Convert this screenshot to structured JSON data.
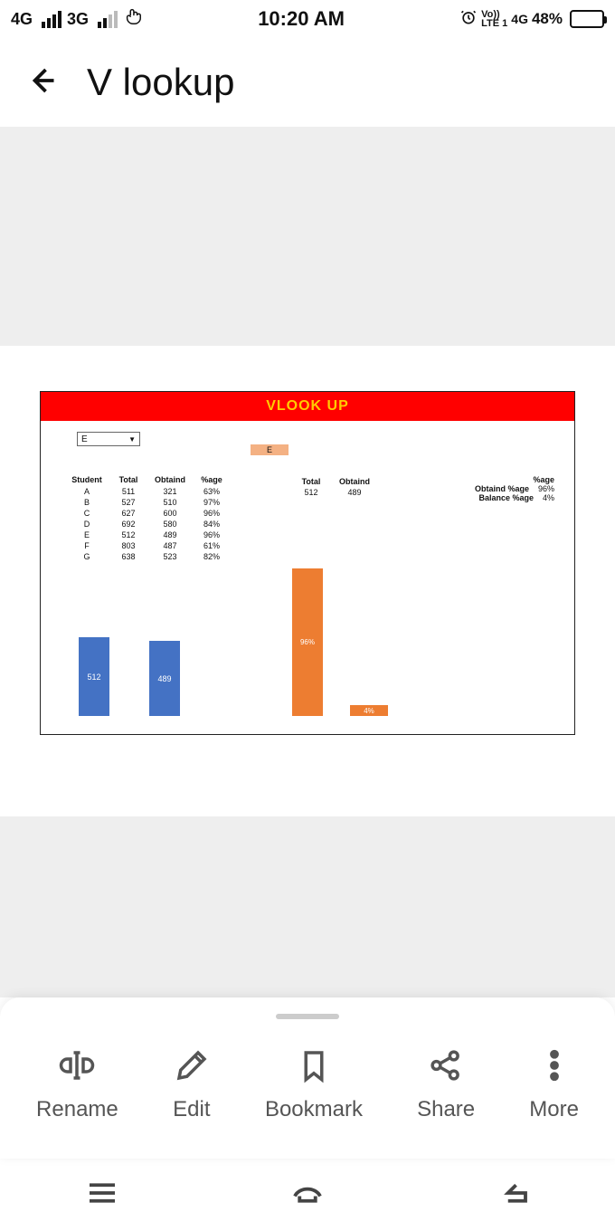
{
  "status": {
    "net1": "4G",
    "net2": "3G",
    "time": "10:20 AM",
    "volte_top": "Vo))",
    "volte_bot": "LTE 1",
    "net3": "4G",
    "battery_pct": "48%",
    "battery_fill": 48
  },
  "header": {
    "title": "V lookup"
  },
  "doc": {
    "title": "VLOOK UP",
    "dropdown_value": "E",
    "selected_chip": "E",
    "table_headers": [
      "Student",
      "Total",
      "Obtaind",
      "%age"
    ],
    "rows": [
      {
        "s": "A",
        "t": "511",
        "o": "321",
        "p": "63%"
      },
      {
        "s": "B",
        "t": "527",
        "o": "510",
        "p": "97%"
      },
      {
        "s": "C",
        "t": "627",
        "o": "600",
        "p": "96%"
      },
      {
        "s": "D",
        "t": "692",
        "o": "580",
        "p": "84%"
      },
      {
        "s": "E",
        "t": "512",
        "o": "489",
        "p": "96%"
      },
      {
        "s": "F",
        "t": "803",
        "o": "487",
        "p": "61%"
      },
      {
        "s": "G",
        "t": "638",
        "o": "523",
        "p": "82%"
      }
    ],
    "lookup_headers": [
      "Total",
      "Obtaind"
    ],
    "lookup_row": {
      "t": "512",
      "o": "489"
    },
    "pct_header": "%age",
    "pct_rows": [
      {
        "lbl": "Obtaind %age",
        "v": "96%"
      },
      {
        "lbl": "Balance %age",
        "v": "4%"
      }
    ]
  },
  "chart_data": [
    {
      "type": "bar",
      "categories": [
        "Total",
        "Obtaind"
      ],
      "values": [
        512,
        489
      ],
      "color": "#4472c4",
      "ylim": [
        0,
        1000
      ]
    },
    {
      "type": "bar",
      "categories": [
        "Obtaind %age",
        "Balance %age"
      ],
      "values": [
        96,
        4
      ],
      "labels": [
        "96%",
        "4%"
      ],
      "color": "#ed7d31",
      "ylim": [
        0,
        100
      ]
    }
  ],
  "actions": {
    "rename": "Rename",
    "edit": "Edit",
    "bookmark": "Bookmark",
    "share": "Share",
    "more": "More"
  }
}
